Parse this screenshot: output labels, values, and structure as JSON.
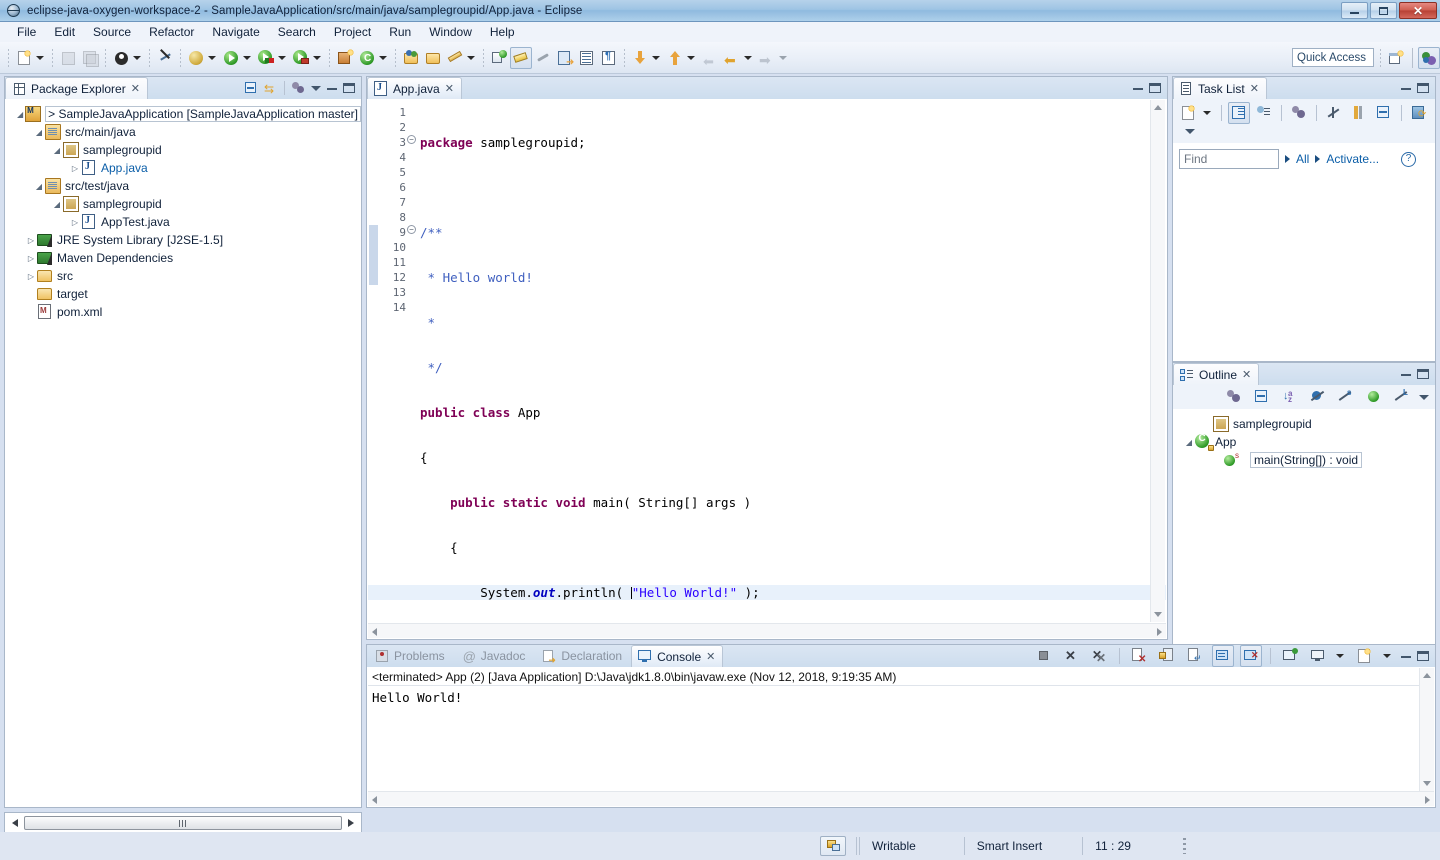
{
  "window": {
    "title": "eclipse-java-oxygen-workspace-2 - SampleJavaApplication/src/main/java/samplegroupid/App.java - Eclipse",
    "app_icon": "eclipse-globe-icon",
    "buttons": {
      "minimize": "minimize-button",
      "restore": "restore-button",
      "close": "close-button"
    }
  },
  "menubar": {
    "items": [
      "File",
      "Edit",
      "Source",
      "Refactor",
      "Navigate",
      "Search",
      "Project",
      "Run",
      "Window",
      "Help"
    ]
  },
  "toolbar": {
    "quick_access_placeholder": "Quick Access",
    "quick_access_value": "Quick Access",
    "buttons": [
      "new-wizard-icon",
      "save-icon",
      "save-all-icon",
      "toggle-user-icon",
      "skip-breakpoints-icon",
      "debug-icon",
      "run-icon",
      "run-coverage-icon",
      "external-tools-icon",
      "new-java-project-icon",
      "new-java-package-icon",
      "open-type-icon",
      "open-task-icon",
      "edit-icon",
      "search-icon",
      "highlight-icon",
      "link-icon",
      "next-annotation-icon",
      "previous-annotation-icon",
      "show-whitespace-icon",
      "back-icon",
      "forward-icon"
    ],
    "perspective_buttons": [
      "open-perspective-icon",
      "java-perspective-icon"
    ]
  },
  "package_explorer": {
    "tab_label": "Package Explorer",
    "toolbar_icons": [
      "collapse-all-icon",
      "link-with-editor-icon",
      "view-menu-icon",
      "minimize-icon",
      "maximize-icon"
    ],
    "tree": [
      {
        "label": "> SampleJavaApplication [SampleJavaApplication master]",
        "icon": "java-project-icon",
        "indent": 0,
        "twist": "expanded",
        "selected": true
      },
      {
        "label": "src/main/java",
        "icon": "source-folder-icon",
        "indent": 1,
        "twist": "expanded",
        "selected": false
      },
      {
        "label": "samplegroupid",
        "icon": "package-icon",
        "indent": 2,
        "twist": "expanded",
        "selected": false
      },
      {
        "label": "App.java",
        "icon": "java-file-icon",
        "indent": 3,
        "twist": "collapsed",
        "selected": false
      },
      {
        "label": "src/test/java",
        "icon": "source-folder-icon",
        "indent": 1,
        "twist": "expanded",
        "selected": false
      },
      {
        "label": "samplegroupid",
        "icon": "package-icon",
        "indent": 2,
        "twist": "expanded",
        "selected": false
      },
      {
        "label": "AppTest.java",
        "icon": "java-file-icon",
        "indent": 3,
        "twist": "collapsed",
        "selected": false
      },
      {
        "label": "JRE System Library",
        "suffix": "[J2SE-1.5]",
        "icon": "library-icon",
        "indent": 1,
        "twist": "collapsed",
        "selected": false
      },
      {
        "label": "Maven Dependencies",
        "icon": "library-icon",
        "indent": 1,
        "twist": "collapsed",
        "selected": false
      },
      {
        "label": "src",
        "icon": "folder-icon",
        "indent": 1,
        "twist": "collapsed",
        "selected": false
      },
      {
        "label": "target",
        "icon": "folder-icon",
        "indent": 1,
        "twist": "none",
        "selected": false
      },
      {
        "label": "pom.xml",
        "icon": "maven-xml-icon",
        "indent": 1,
        "twist": "none",
        "selected": false
      }
    ]
  },
  "editor": {
    "tab_label": "App.java",
    "tab_icon": "java-file-icon",
    "close_glyph": "╳",
    "current_line": 11,
    "folded_lines": [
      3,
      9
    ],
    "occurrence_marker_lines": [
      9,
      10,
      11,
      12
    ],
    "lines": [
      {
        "no": 1,
        "text": "package samplegroupid;"
      },
      {
        "no": 2,
        "text": ""
      },
      {
        "no": 3,
        "text": "/**"
      },
      {
        "no": 4,
        "text": " * Hello world!"
      },
      {
        "no": 5,
        "text": " *"
      },
      {
        "no": 6,
        "text": " */"
      },
      {
        "no": 7,
        "text": "public class App"
      },
      {
        "no": 8,
        "text": "{"
      },
      {
        "no": 9,
        "text": "    public static void main( String[] args )"
      },
      {
        "no": 10,
        "text": "    {"
      },
      {
        "no": 11,
        "text": "        System.out.println( \"Hello World!\" );"
      },
      {
        "no": 12,
        "text": "    }"
      },
      {
        "no": 13,
        "text": "}"
      },
      {
        "no": 14,
        "text": ""
      }
    ]
  },
  "task_list": {
    "tab_label": "Task List",
    "toolbar_icons": [
      "new-task-icon",
      "categorized-presentation-icon",
      "scheduled-presentation-icon",
      "focus-on-workweek-icon",
      "filter-completed-icon",
      "show-all-icon",
      "collapse-all-icon",
      "synchronize-changed-icon",
      "view-menu-icon"
    ],
    "find_placeholder": "Find",
    "find_value": "Find",
    "filter_all": "All",
    "filter_activate": "Activate...",
    "help_label": "?"
  },
  "outline": {
    "tab_label": "Outline",
    "toolbar_icons": [
      "focus-on-active-task-icon",
      "collapse-all-icon",
      "sort-icon",
      "hide-fields-icon",
      "hide-static-icon",
      "hide-non-public-icon",
      "hide-local-types-icon",
      "view-menu-icon"
    ],
    "tree": [
      {
        "label": "samplegroupid",
        "icon": "package-icon",
        "indent": 1,
        "twist": "none",
        "selected": false
      },
      {
        "label": "App",
        "icon": "class-icon",
        "indent": 1,
        "twist": "expanded",
        "selected": false
      },
      {
        "label": "main(String[]) : void",
        "icon": "method-public-static-icon",
        "indent": 2,
        "twist": "none",
        "selected": true
      }
    ]
  },
  "console": {
    "tabs": [
      {
        "label": "Problems",
        "icon": "problems-icon",
        "active": false
      },
      {
        "label": "Javadoc",
        "icon": "javadoc-icon",
        "active": false
      },
      {
        "label": "Declaration",
        "icon": "declaration-icon",
        "active": false
      },
      {
        "label": "Console",
        "icon": "console-icon",
        "active": true
      }
    ],
    "close_glyph": "╳",
    "header": "<terminated> App (2) [Java Application] D:\\Java\\jdk1.8.0\\bin\\javaw.exe (Nov 12, 2018, 9:19:35 AM)",
    "output": "Hello World!",
    "toolbar_icons": [
      "terminate-icon",
      "remove-launch-icon",
      "remove-all-terminated-icon",
      "clear-console-icon",
      "scroll-lock-icon",
      "word-wrap-icon",
      "show-console-on-output-icon",
      "show-console-on-error-icon",
      "pin-console-icon",
      "display-selected-console-icon",
      "open-console-icon",
      "minimize-icon",
      "maximize-icon"
    ]
  },
  "statusbar": {
    "writable": "Writable",
    "insert_mode": "Smart Insert",
    "cursor_position": "11 : 29",
    "left_icon": "git-repository-icon"
  },
  "colors": {
    "titlebar_blue": "#9ec4e4",
    "accent_link": "#0b5ea8",
    "keyword": "#7f0055",
    "comment": "#3f5fbf",
    "string": "#2a00ff",
    "field": "#0000c0",
    "current_line_highlight": "#e8f1fb",
    "panel_bg": "#eef3fa",
    "window_bg": "#d6e0f0"
  }
}
